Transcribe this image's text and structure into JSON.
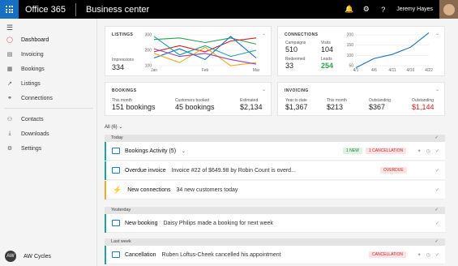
{
  "topbar": {
    "brand": "Office 365",
    "app_name": "Business center",
    "user": "Jeremy Hayes"
  },
  "sidebar": {
    "items": [
      {
        "label": "Dashboard",
        "icon": "dashboard-icon",
        "active": true
      },
      {
        "label": "Invoicing",
        "icon": "invoice-icon"
      },
      {
        "label": "Bookings",
        "icon": "calendar-icon"
      },
      {
        "label": "Listings",
        "icon": "chart-icon"
      },
      {
        "label": "Connections",
        "icon": "connections-icon"
      },
      {
        "label": "Contacts",
        "icon": "contacts-icon"
      },
      {
        "label": "Downloads",
        "icon": "download-icon"
      },
      {
        "label": "Settings",
        "icon": "gear-icon"
      }
    ],
    "footer": "AW Cycles"
  },
  "listings": {
    "title": "LISTINGS",
    "impressions_label": "Impressions",
    "impressions_value": "334",
    "y_ticks": [
      "300",
      "200",
      "100"
    ],
    "x_ticks": [
      "Jan",
      "Feb",
      "Mar"
    ]
  },
  "connections": {
    "title": "CONNECTIONS",
    "campaigns_label": "Campaigns",
    "campaigns_value": "510",
    "visits_label": "Visits",
    "visits_value": "104",
    "redeemed_label": "Redeemed",
    "redeemed_value": "33",
    "leads_label": "Leads",
    "leads_value": "254",
    "y_ticks": [
      "200",
      "150",
      "100",
      "50"
    ],
    "x_ticks": [
      "4/1",
      "4/6",
      "4/11",
      "4/16",
      "4/22"
    ]
  },
  "bookings": {
    "title": "BOOKINGS",
    "this_month_label": "This month",
    "this_month_value": "151 bookings",
    "customers_label": "Customers booked",
    "customers_value": "45 bookings",
    "estimated_label": "Estimated",
    "estimated_value": "$2,134"
  },
  "invoicing": {
    "title": "INVOICING",
    "ytd_label": "Year to date",
    "ytd_value": "$1,367",
    "month_label": "This month",
    "month_value": "$213",
    "outstanding_label": "Outstanding",
    "outstanding_value": "$367",
    "overdue_label": "Outstanding",
    "overdue_value": "$1,144"
  },
  "feed": {
    "filter": "All (6)",
    "groups": {
      "today": "Today",
      "yesterday": "Yesterday",
      "last_week": "Last week"
    },
    "rows": [
      {
        "title": "Bookings Activity (5)",
        "desc": "",
        "badges": [
          "1 NEW",
          "1 CANCELLATION"
        ]
      },
      {
        "title": "Overdue invoice",
        "desc": "Invoice #22 of $649.98 by Robin Count is overd...",
        "badges": [
          "OVERDUE"
        ]
      },
      {
        "title": "New connections",
        "desc": "34 new customers today",
        "badges": []
      },
      {
        "title": "New booking",
        "desc": "Daisy Philips made a booking for next week",
        "badges": []
      },
      {
        "title": "Cancellation",
        "desc": "Ruben Loftus-Cheek cancelled his appointment",
        "badges": [
          "CANCELLATION"
        ]
      }
    ]
  },
  "colors": {
    "accent": "#1570c3",
    "teal": "#1ba39c",
    "orange": "#f5a623",
    "red": "#d62020",
    "green": "#2ea44f"
  },
  "chart_data": [
    {
      "type": "line",
      "x": [
        "Jan",
        "",
        "Feb",
        "",
        "Mar"
      ],
      "series": [
        {
          "values": [
            270,
            280,
            250,
            280,
            240
          ]
        },
        {
          "values": [
            190,
            230,
            190,
            260,
            280
          ]
        },
        {
          "values": [
            150,
            210,
            140,
            290,
            150
          ]
        },
        {
          "values": [
            180,
            120,
            220,
            100,
            120
          ]
        },
        {
          "values": [
            210,
            160,
            180,
            140,
            110
          ]
        },
        {
          "values": [
            290,
            170,
            230,
            160,
            200
          ]
        }
      ],
      "ylim": [
        100,
        300
      ]
    },
    {
      "type": "line",
      "x": [
        "4/1",
        "4/6",
        "4/11",
        "4/16",
        "4/22"
      ],
      "series": [
        {
          "values": [
            40,
            85,
            105,
            140,
            210
          ]
        }
      ],
      "ylim": [
        50,
        200
      ]
    }
  ]
}
